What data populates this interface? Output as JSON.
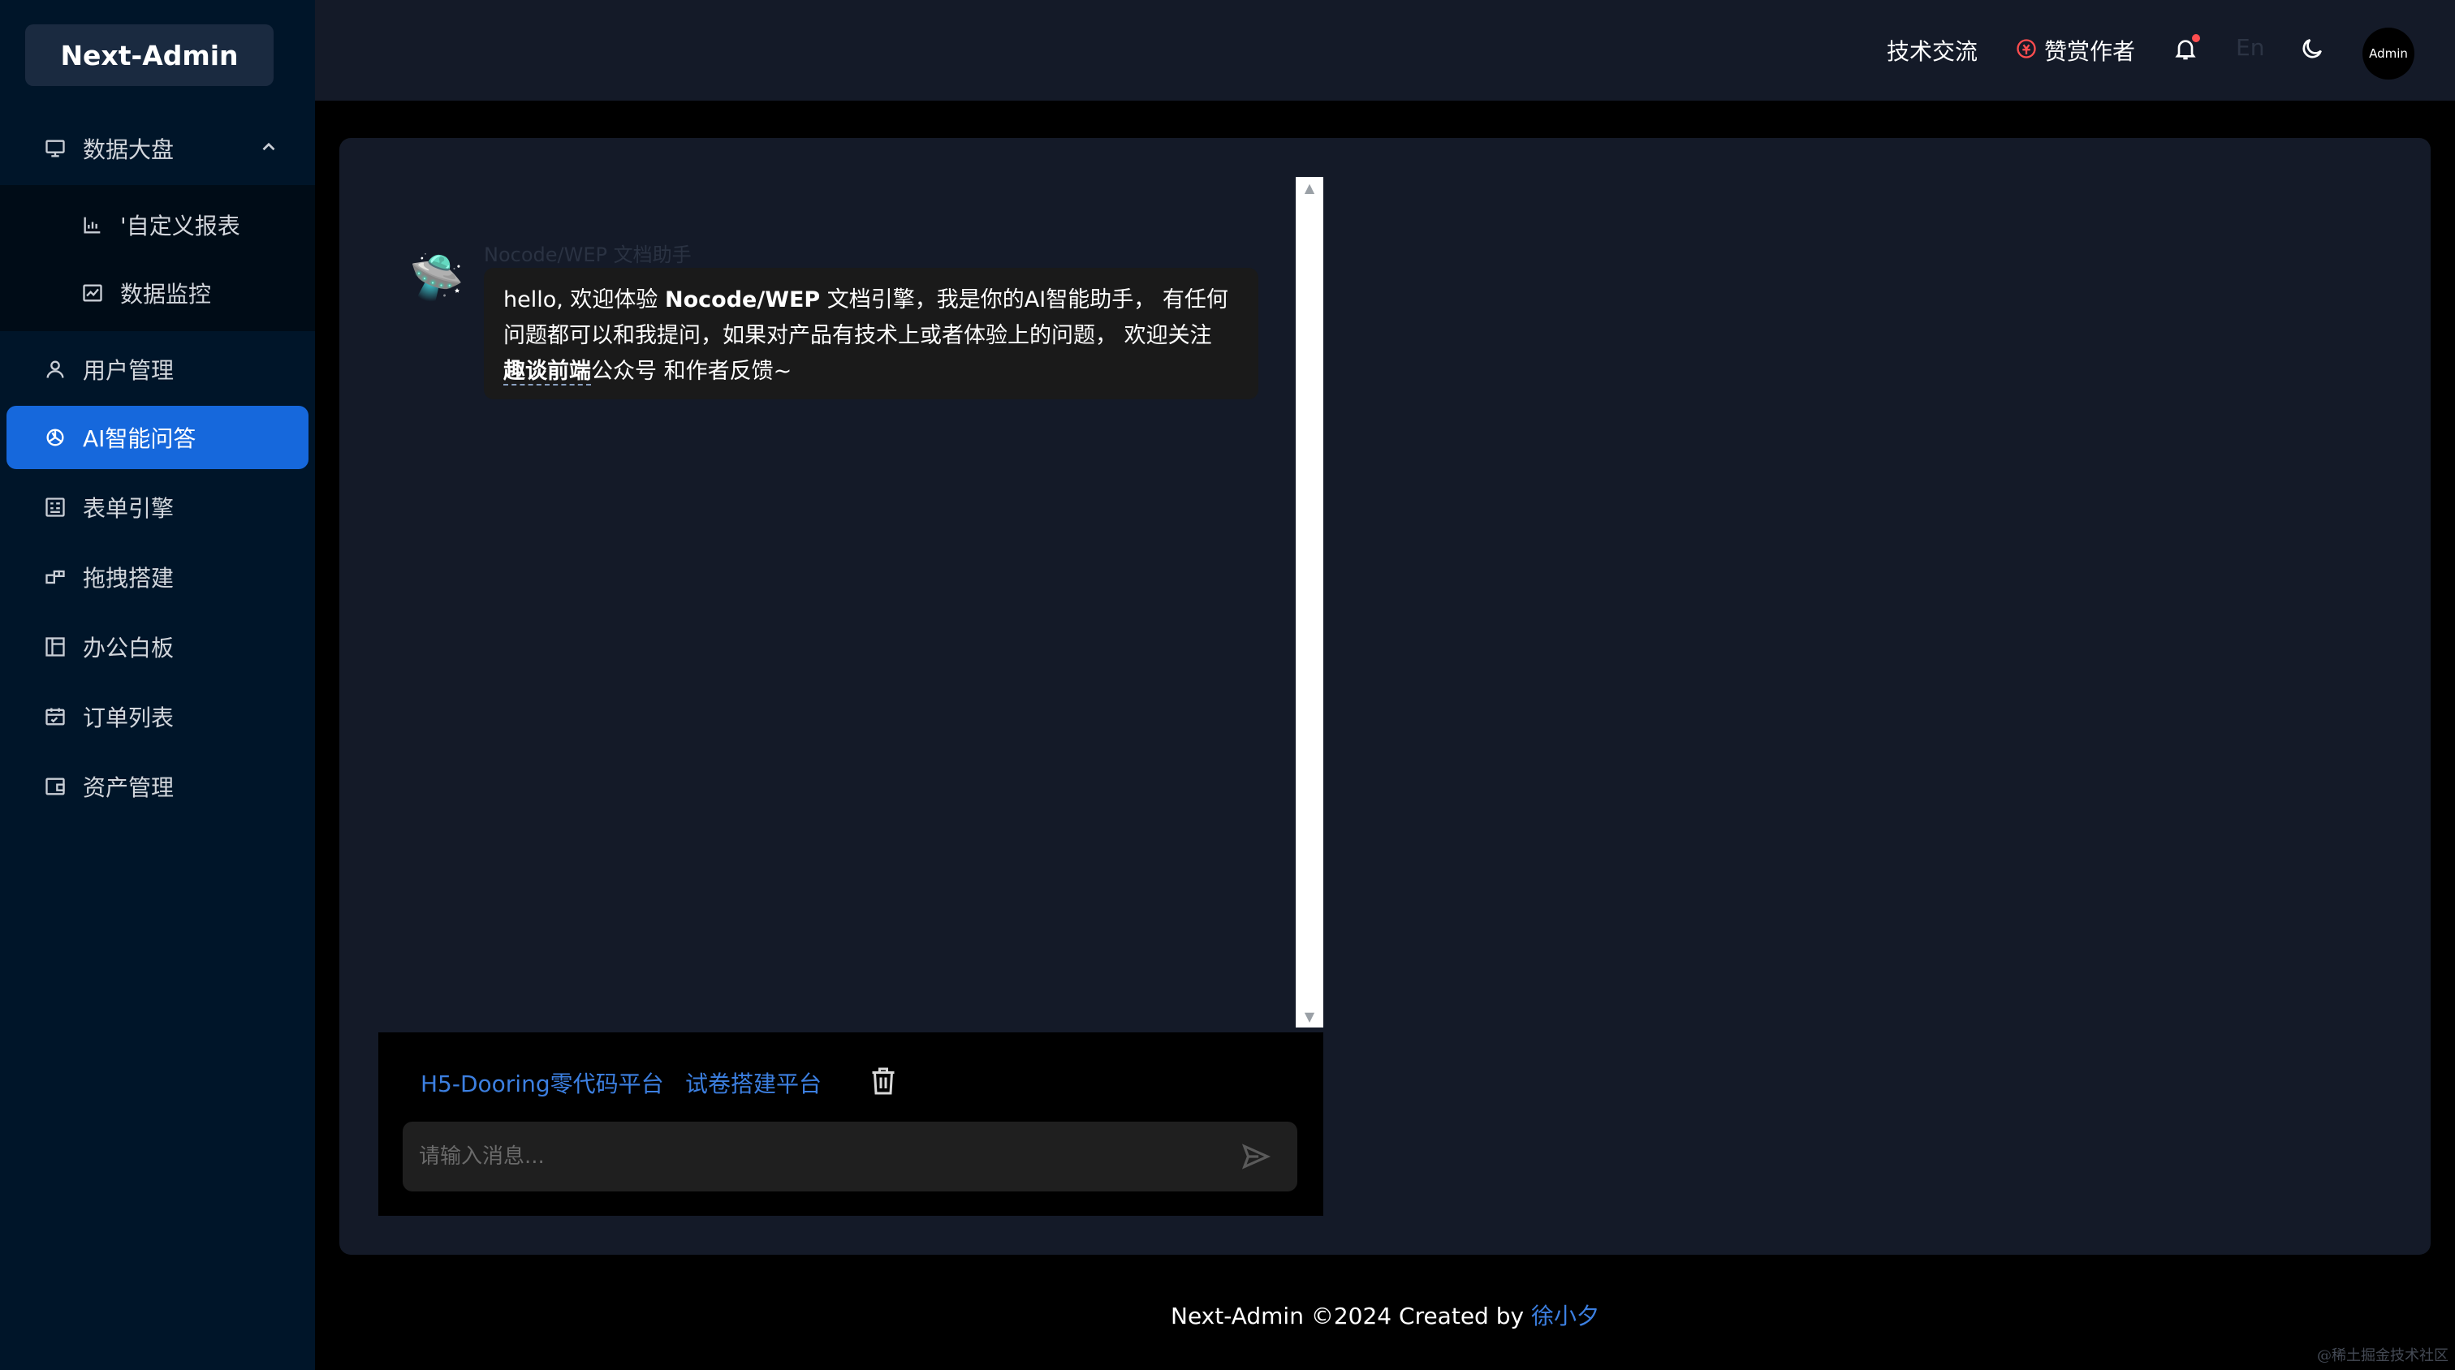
{
  "app": {
    "logo": "Next-Admin"
  },
  "sidebar": {
    "items": [
      {
        "label": "数据大盘",
        "icon": "monitor-icon",
        "expanded": true,
        "children": [
          {
            "label": "'自定义报表",
            "icon": "bar-chart-icon"
          },
          {
            "label": "数据监控",
            "icon": "line-chart-icon"
          }
        ]
      },
      {
        "label": "用户管理",
        "icon": "user-icon"
      },
      {
        "label": "AI智能问答",
        "icon": "openai-icon",
        "active": true
      },
      {
        "label": "表单引擎",
        "icon": "form-icon"
      },
      {
        "label": "拖拽搭建",
        "icon": "drag-icon"
      },
      {
        "label": "办公白板",
        "icon": "whiteboard-icon"
      },
      {
        "label": "订单列表",
        "icon": "calendar-icon"
      },
      {
        "label": "资产管理",
        "icon": "wallet-icon"
      }
    ]
  },
  "header": {
    "tech_exchange": "技术交流",
    "sponsor": "赞赏作者",
    "lang": "En",
    "avatar_text": "Admin",
    "icons": [
      "sponsor-icon",
      "bell-icon",
      "moon-icon"
    ],
    "has_notification": true
  },
  "chat": {
    "bot_avatar": "🛸",
    "bot_name": "Nocode/WEP 文档助手",
    "message": {
      "p1": "hello, 欢迎体验 ",
      "b1": "Nocode/WEP",
      "p2": " 文档引擎，我是你的AI智能助手， 有任何问题都可以和我提问，如果对产品有技术上或者体验上的问题， 欢迎关注 ",
      "b2": "趣谈前端",
      "p3": "公众号 和作者反馈~"
    },
    "quick_links": [
      "H5-Dooring零代码平台",
      "试卷搭建平台"
    ],
    "input_placeholder": "请输入消息..."
  },
  "footer": {
    "text": "Next-Admin ©2024 Created by ",
    "author": "徐小夕"
  },
  "watermark": "@稀土掘金技术社区",
  "colors": {
    "sidebar_bg": "#001529",
    "active_item": "#1668dc",
    "link": "#3c7fe0",
    "card_bg": "#141a28",
    "sponsor_red": "#ff4d4f"
  }
}
